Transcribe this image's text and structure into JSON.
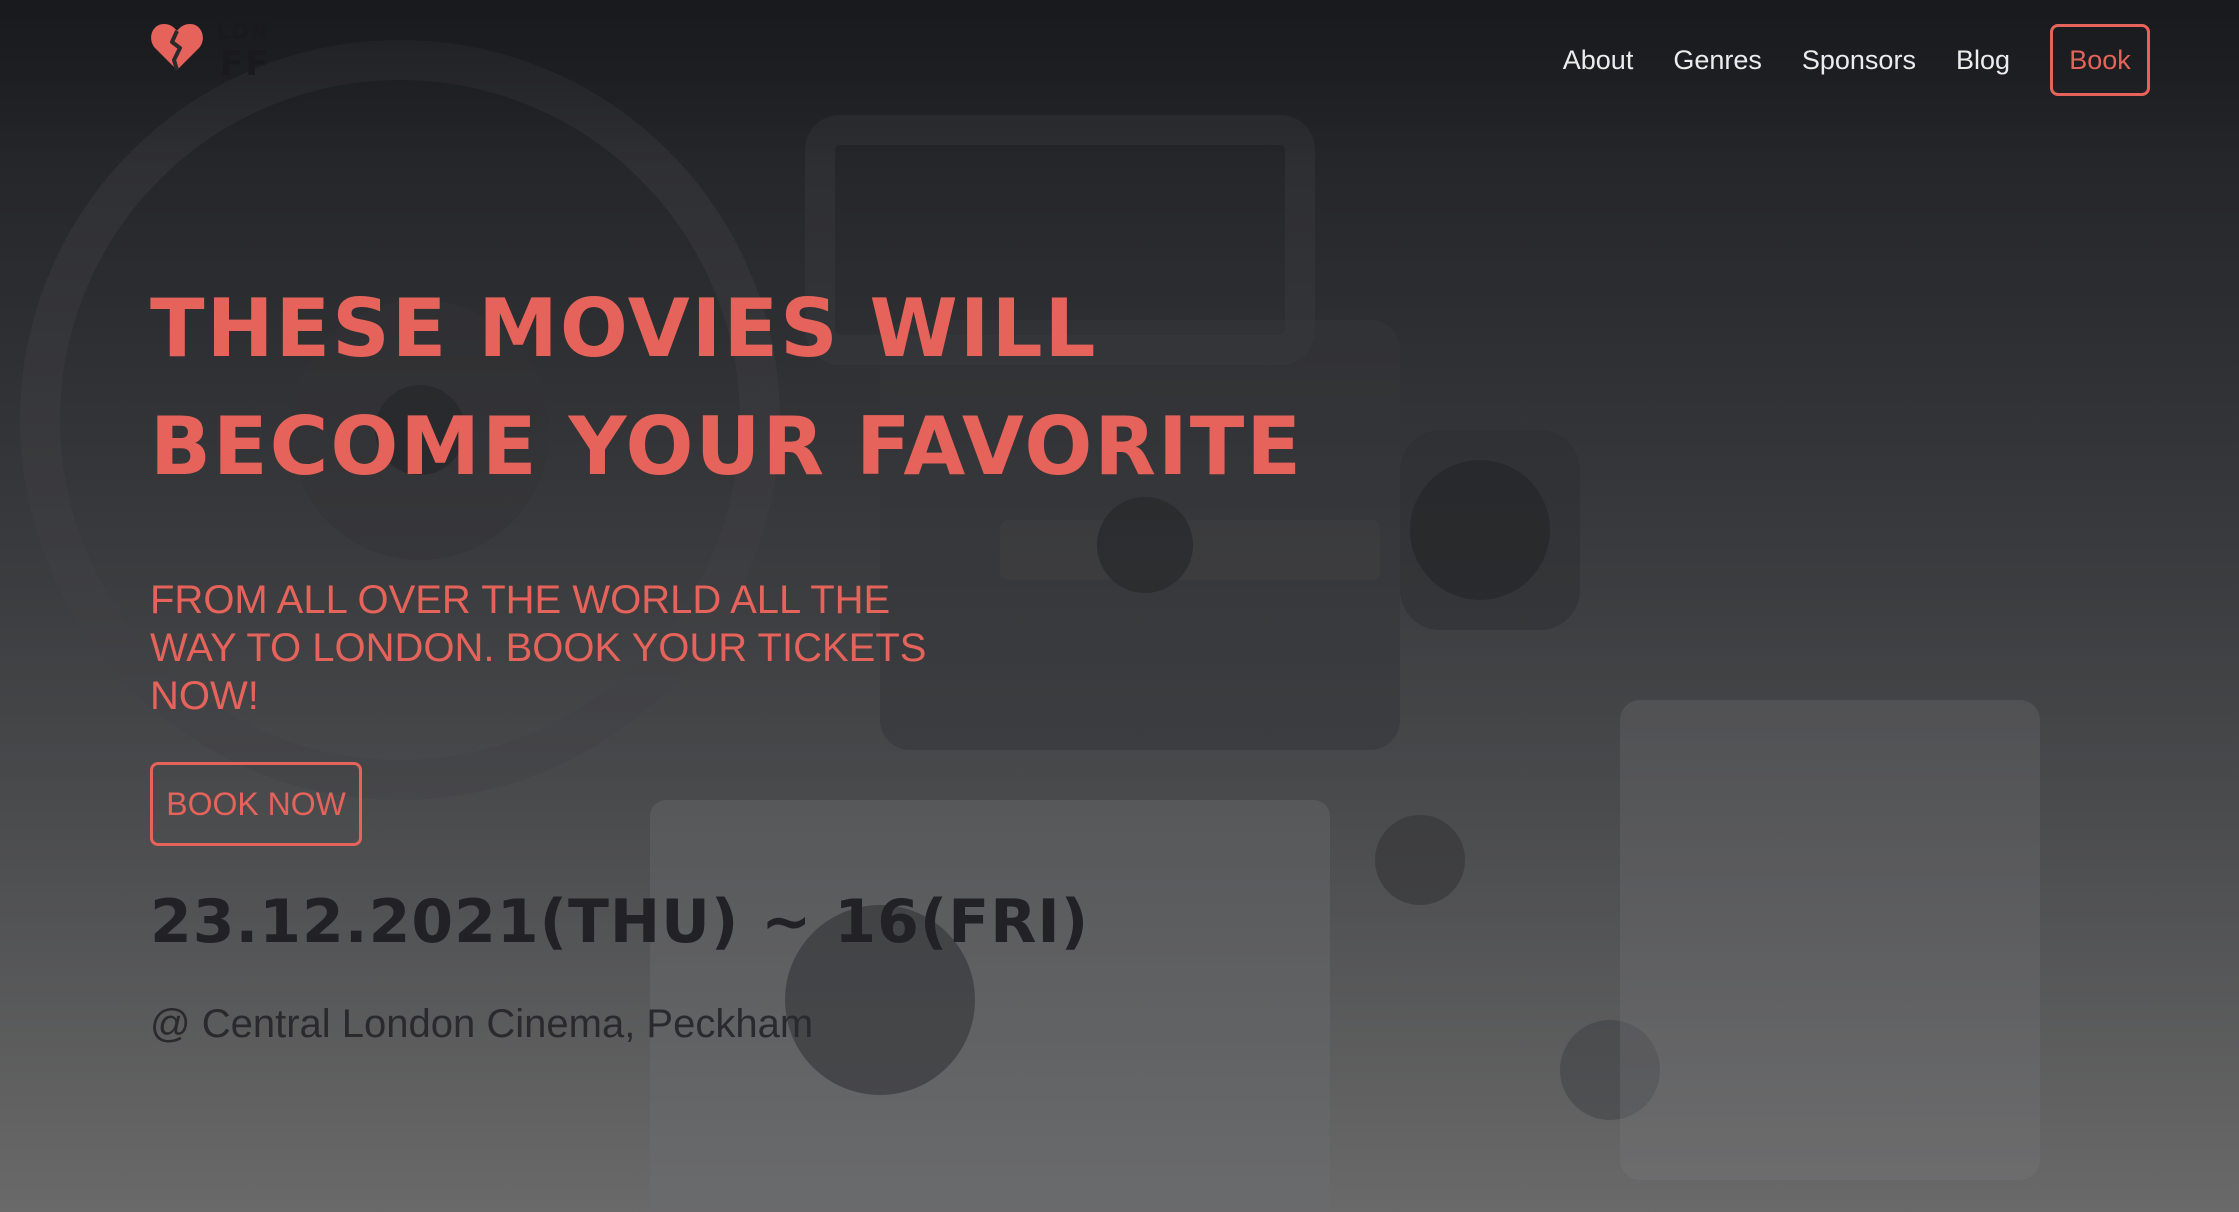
{
  "brand": {
    "logo_top": "LDN",
    "logo_bottom": "FF",
    "logo_icon": "broken-heart-icon",
    "accent_color": "#e5635a"
  },
  "nav": {
    "items": [
      {
        "label": "About"
      },
      {
        "label": "Genres"
      },
      {
        "label": "Sponsors"
      },
      {
        "label": "Blog"
      }
    ],
    "book_label": "Book"
  },
  "hero": {
    "headline_line1": "THESE MOVIES WILL",
    "headline_line2": "BECOME YOUR FAVORITE",
    "subhead": "FROM ALL OVER THE WORLD ALL THE WAY TO LONDON. BOOK YOUR TICKETS NOW!",
    "cta_label": "BOOK NOW",
    "date": "23.12.2021(THU) ~ 16(FRI)",
    "venue": "@ Central London Cinema, Peckham",
    "background_image": "film-projector-photo"
  }
}
